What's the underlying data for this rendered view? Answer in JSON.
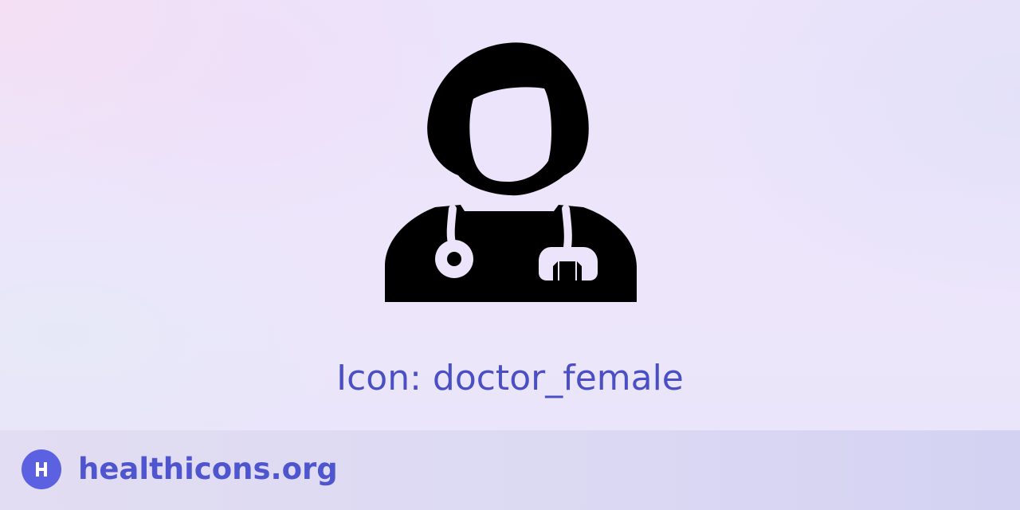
{
  "icon": {
    "name": "doctor-female-icon",
    "color": "#000000"
  },
  "caption": {
    "text": "Icon: doctor_female",
    "color": "#4a4fc4"
  },
  "footer": {
    "site": "healthicons.org",
    "logo_icon": "healthicons-logo-icon",
    "logo_color": "#5b61e0"
  }
}
